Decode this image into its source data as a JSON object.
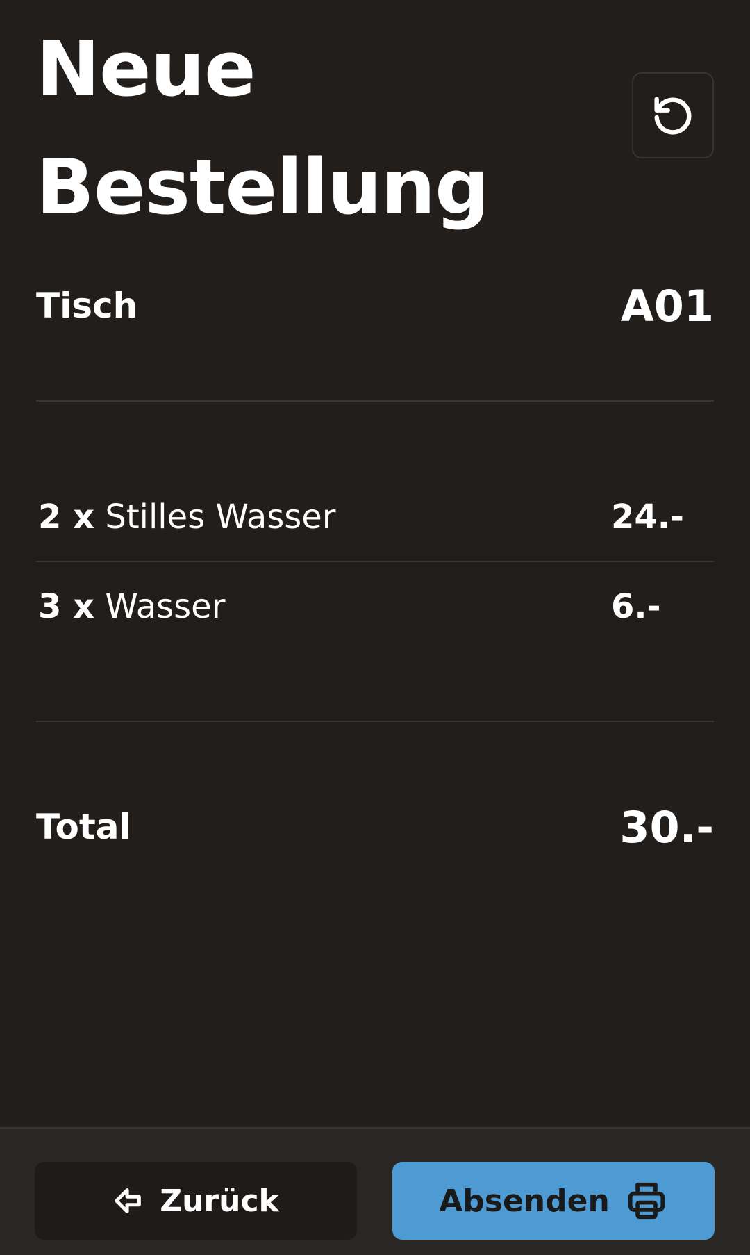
{
  "header": {
    "title_line1": "Neue",
    "title_line2": "Bestellung"
  },
  "table": {
    "label": "Tisch",
    "value": "A01"
  },
  "items": [
    {
      "qty": "2 x",
      "name": "Stilles Wasser",
      "price": "24.-"
    },
    {
      "qty": "3 x",
      "name": "Wasser",
      "price": "6.-"
    }
  ],
  "total": {
    "label": "Total",
    "value": "30.-"
  },
  "footer": {
    "back_label": "Zurück",
    "send_label": "Absenden"
  },
  "colors": {
    "background": "#221e1c",
    "accent": "#4e9bd4"
  },
  "icons": {
    "reset": "reset-icon",
    "back": "arrow-left-icon",
    "send": "printer-icon"
  }
}
